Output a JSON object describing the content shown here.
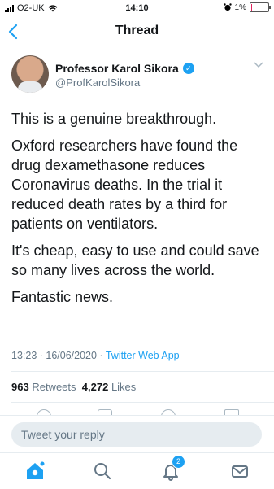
{
  "status": {
    "carrier": "O2-UK",
    "time": "14:10",
    "battery": "1%"
  },
  "nav": {
    "title": "Thread"
  },
  "tweet": {
    "name": "Professor Karol Sikora",
    "handle": "@ProfKarolSikora",
    "paragraphs": [
      "This is a genuine breakthrough.",
      "Oxford researchers have found the drug dexamethasone reduces Coronavirus deaths. In the trial it reduced death rates by a third for patients on ventilators.",
      "It's cheap, easy to use and could save so many lives across the world.",
      "Fantastic news."
    ],
    "timestamp": "13:23 · 16/06/2020 · ",
    "source": "Twitter Web App",
    "retweets_count": "963",
    "retweets_label": "Retweets",
    "likes_count": "4,272",
    "likes_label": "Likes"
  },
  "reply": {
    "placeholder": "Tweet your reply"
  },
  "tabbar": {
    "notifications_badge": "2"
  },
  "colors": {
    "accent": "#1da1f2",
    "text": "#14171a",
    "muted": "#657786"
  }
}
